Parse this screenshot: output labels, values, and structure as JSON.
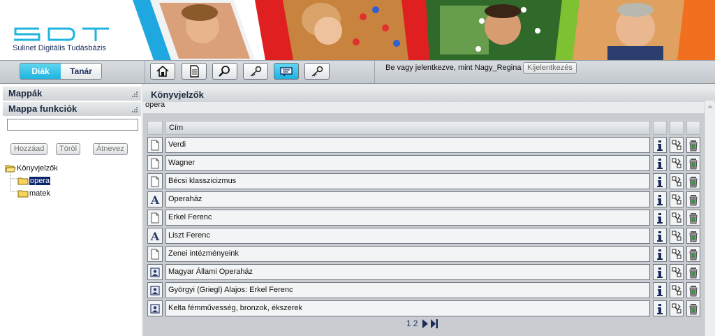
{
  "header": {
    "logo_text": "SDT",
    "subtitle": "Sulinet Digitális Tudásbázis"
  },
  "colors": {
    "accent": "#1fb4df",
    "selection": "#0a246a",
    "panel_bg": "#e9ebed"
  },
  "toolbar": {
    "roles": [
      {
        "label": "Diák",
        "active": true
      },
      {
        "label": "Tanár",
        "active": false
      }
    ],
    "buttons": [
      {
        "icon": "home-icon",
        "active": false
      },
      {
        "icon": "document-icon",
        "active": false
      },
      {
        "icon": "search-icon",
        "active": false
      },
      {
        "icon": "key-icon",
        "active": false
      },
      {
        "icon": "bookmark-icon",
        "active": true
      },
      {
        "icon": "key-icon",
        "active": false
      }
    ],
    "login_status": "Be vagy jelentkezve, mint Nagy_Regina",
    "logout_label": "Kijelentkezés"
  },
  "left_panel": {
    "folders_title": "Mappák",
    "functions_title": "Mappa funkciók",
    "name_input": {
      "value": "",
      "placeholder": ""
    },
    "buttons": {
      "add": "Hozzáad",
      "delete": "Töröl",
      "rename": "Átnevez"
    },
    "tree": {
      "root": "Könyvjelzők",
      "children": [
        {
          "label": "opera",
          "selected": true
        },
        {
          "label": "matek",
          "selected": false
        }
      ]
    }
  },
  "main": {
    "title": "Könyvjelzők",
    "folder": "opera",
    "column_title": "Cím",
    "rows": [
      {
        "type": "document",
        "icon": "document-icon",
        "title": "Verdi"
      },
      {
        "type": "document",
        "icon": "document-icon",
        "title": "Wagner"
      },
      {
        "type": "document",
        "icon": "document-icon",
        "title": "Bécsi klasszicizmus"
      },
      {
        "type": "lexicon",
        "icon": "letter-a-icon",
        "title": "Operaház"
      },
      {
        "type": "document",
        "icon": "document-icon",
        "title": "Erkel Ferenc"
      },
      {
        "type": "lexicon",
        "icon": "letter-a-icon",
        "title": "Liszt Ferenc"
      },
      {
        "type": "document",
        "icon": "document-icon",
        "title": "Zenei intézményeink"
      },
      {
        "type": "image",
        "icon": "portrait-image-icon",
        "title": "Magyar Állami Operaház"
      },
      {
        "type": "image",
        "icon": "portrait-image-icon",
        "title": "Györgyi (Griegl) Alajos: Erkel Ferenc"
      },
      {
        "type": "image",
        "icon": "portrait-image-icon",
        "title": "Kelta fémművesség, bronzok, ékszerek"
      }
    ],
    "row_actions": [
      "info-icon",
      "move-icon",
      "trash-icon"
    ],
    "pager": {
      "pages": [
        "1",
        "2"
      ],
      "next_icon": "next-page-icon",
      "last_icon": "last-page-icon"
    }
  }
}
